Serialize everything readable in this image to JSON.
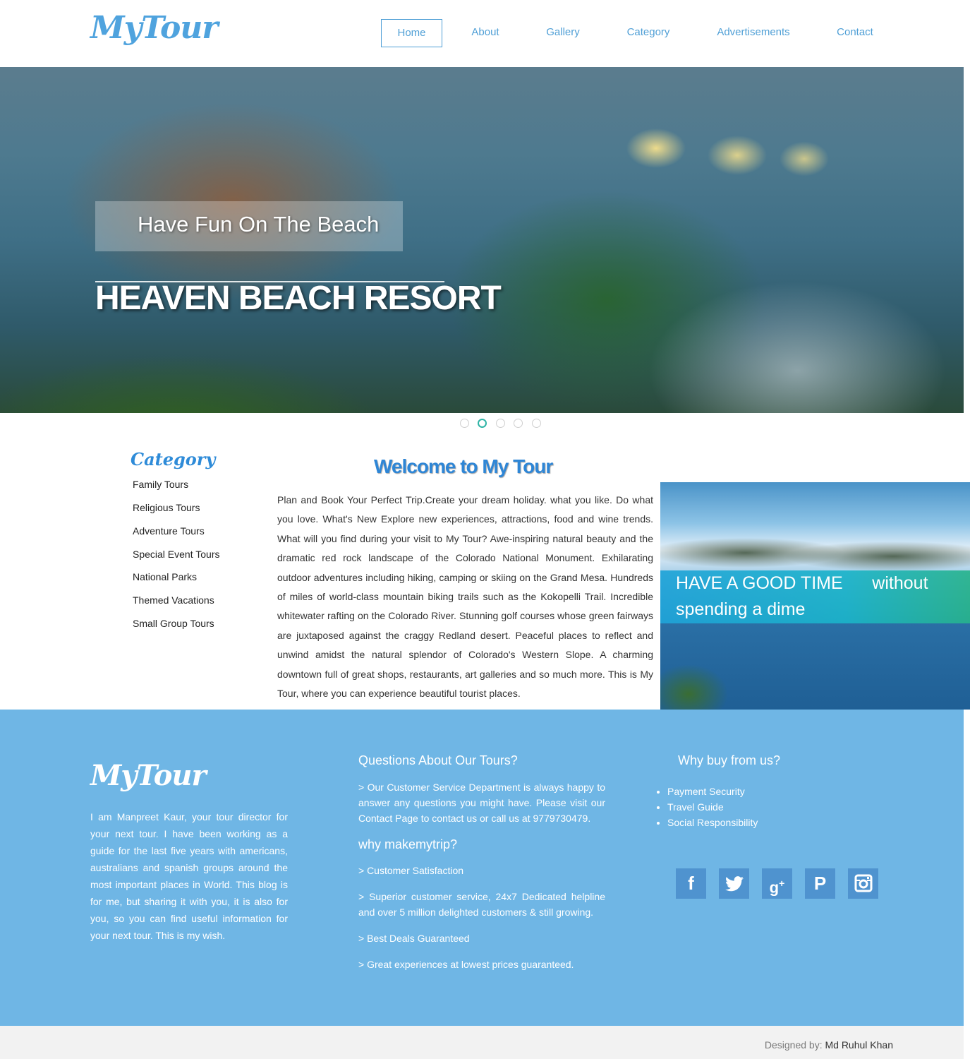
{
  "header": {
    "logo": "MyTour",
    "nav": [
      "Home",
      "About",
      "Gallery",
      "Category",
      "Advertisements",
      "Contact"
    ],
    "active_nav": "Home"
  },
  "hero": {
    "subtitle": "Have Fun On The Beach",
    "title": "HEAVEN BEACH RESORT",
    "slide_count": 5,
    "active_slide": 2
  },
  "category": {
    "title": "Category",
    "items": [
      "Family Tours",
      "Religious Tours",
      "Adventure Tours",
      "Special Event Tours",
      "National Parks",
      "Themed Vacations",
      "Small Group Tours"
    ]
  },
  "main": {
    "welcome": "Welcome to My Tour",
    "intro": "Plan and Book Your Perfect Trip.Create your dream holiday. what you like. Do what you love. What's New Explore new experiences, attractions, food and wine trends. What will you find during your visit to My Tour? Awe-inspiring natural beauty and the dramatic red rock landscape of the Colorado National Monument. Exhilarating outdoor adventures including hiking, camping or skiing on the Grand Mesa. Hundreds of miles of world-class mountain biking trails such as the Kokopelli Trail. Incredible whitewater rafting on the Colorado River. Stunning golf courses whose green fairways are juxtaposed against the craggy Redland desert. Peaceful places to reflect and unwind amidst the natural splendor of Colorado's Western Slope. A charming downtown full of great shops, restaurants, art galleries and so much more. This is My Tour, where you can experience beautiful tourist places.",
    "side_banner": "HAVE A GOOD TIME      without spending a dime"
  },
  "footer": {
    "logo": "MyTour",
    "about": "I am Manpreet Kaur, your tour director for your next tour. I have been working as a guide for the last five years with americans, australians and spanish groups around the most important places in World. This blog is for me, but sharing it with you, it is also for you, so you can find useful information for your next tour. This is my wish.",
    "questions_heading": "Questions About Our Tours?",
    "questions_text": ">  Our Customer Service Department is always happy to answer any questions you might have. Please visit our Contact Page to contact us or call us at 9779730479.",
    "why_heading": "why makemytrip?",
    "why_items": [
      ">  Customer Satisfaction",
      ">  Superior customer service, 24x7 Dedicated helpline and over 5 million delighted customers & still growing.",
      ">  Best Deals Guaranteed",
      ">  Great experiences at lowest prices guaranteed."
    ],
    "buy_heading": "Why buy from us?",
    "buy_items": [
      "Payment Security",
      "Travel Guide",
      "Social Responsibility"
    ],
    "social": [
      "facebook-icon",
      "twitter-icon",
      "google-plus-icon",
      "pinterest-icon",
      "instagram-icon"
    ]
  },
  "credit": {
    "label": "Designed by:",
    "name": "Md Ruhul Khan"
  },
  "colors": {
    "accent": "#4f9fd6",
    "footer_bg": "#6fb6e5",
    "dot_active": "#2fb4a6"
  }
}
